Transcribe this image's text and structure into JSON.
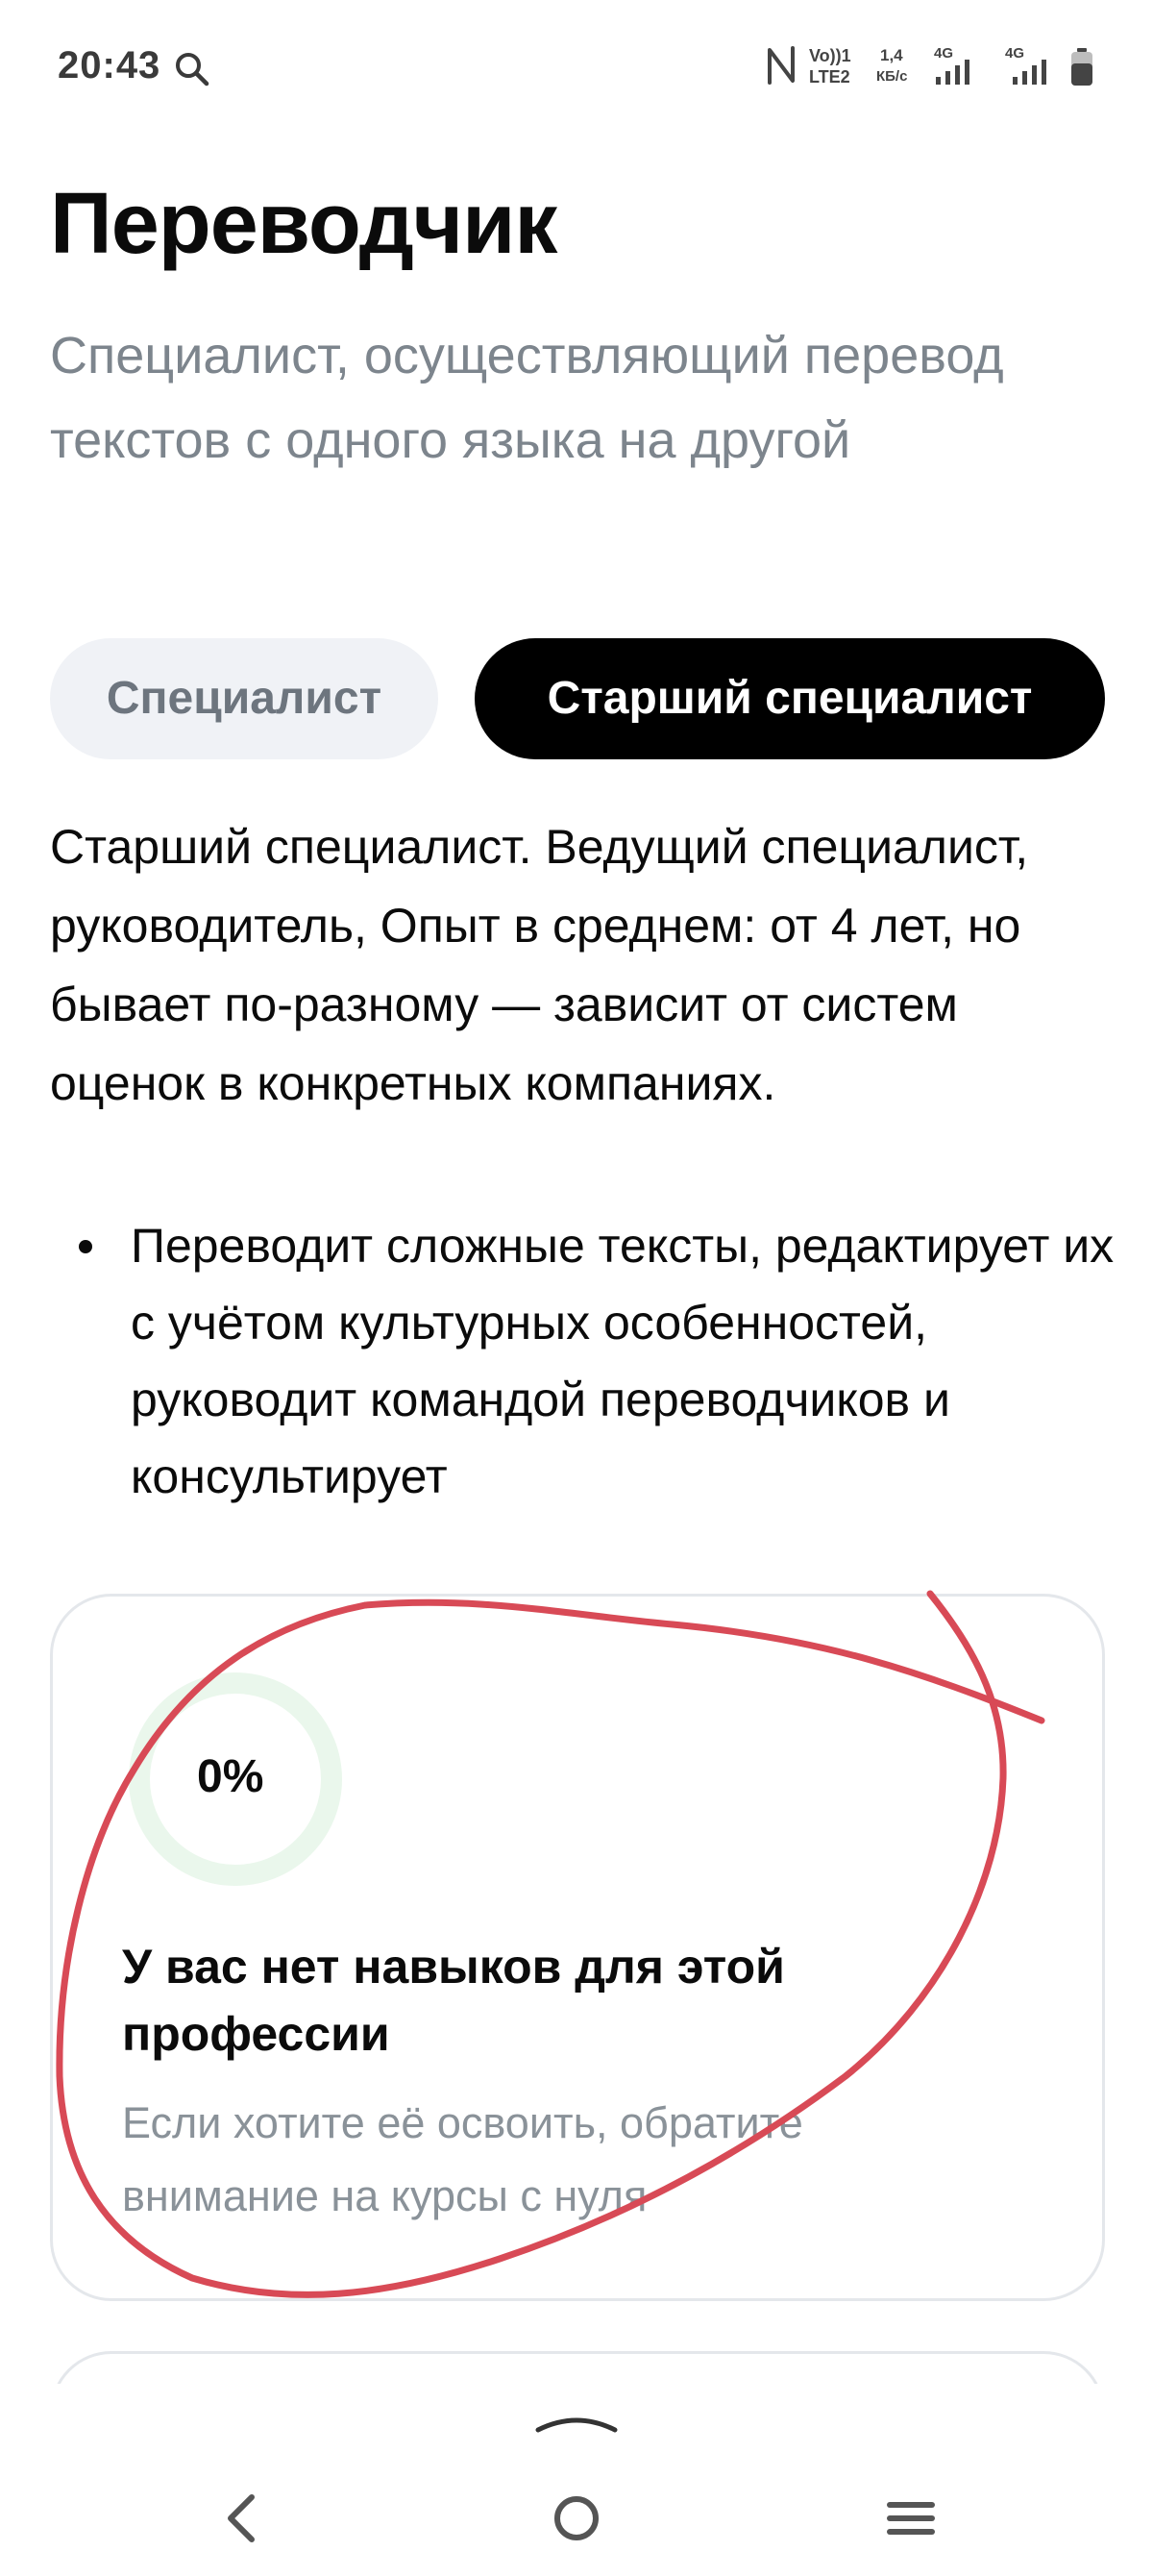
{
  "status_bar": {
    "time": "20:43",
    "volte": "Vo LTE2",
    "volte_top": "Vo))1",
    "volte_bottom": "LTE2",
    "speed_top": "1,4",
    "speed_bottom": "КБ/с",
    "net1": "4G",
    "net2": "4G",
    "icons": [
      "search-icon",
      "nfc-icon",
      "signal-icon",
      "battery-icon"
    ]
  },
  "header": {
    "title": "Переводчик",
    "subtitle": "Специалист, осуществляющий перевод текстов с одного языка на другой"
  },
  "tabs": [
    {
      "label": "Специалист",
      "selected": false
    },
    {
      "label": "Старший специалист",
      "selected": true
    }
  ],
  "level": {
    "description": "Старший специалист. Ведущий специалист, руководитель, Опыт в среднем: от 4 лет, но бывает по-разному — зависит от систем оценок в конкретных компаниях.",
    "duties": [
      "Переводит сложные тексты, редактирует их с учётом культурных особенностей, руководит командой переводчиков и консультирует"
    ]
  },
  "skills_card": {
    "progress": 0,
    "progress_label": "0%",
    "heading": "У вас нет навыков для этой профессии",
    "hint": "Если хотите её освоить, обратите внимание на курсы с нуля"
  },
  "colors": {
    "accent_black": "#000000",
    "muted_text": "#7d858d",
    "tab_inactive_bg": "#f0f2f6",
    "ring_track": "#eaf7ec",
    "annotation_red": "#d84a56"
  },
  "nav": {
    "icons": [
      "chevron-up-icon",
      "back-icon",
      "home-icon",
      "menu-icon"
    ]
  }
}
